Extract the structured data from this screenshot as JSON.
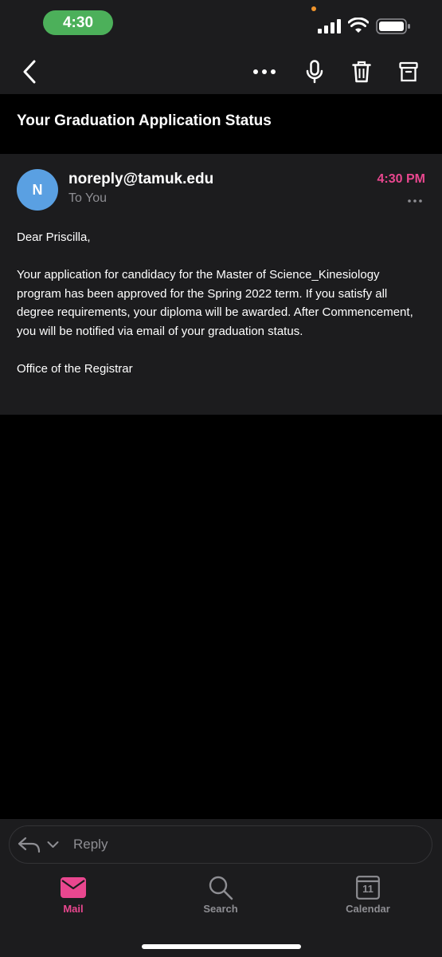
{
  "status_bar": {
    "time": "4:30"
  },
  "toolbar": {
    "back": "back-chevron-icon",
    "more": "more-horizontal-icon",
    "mic": "microphone-icon",
    "delete": "trash-icon",
    "archive": "archive-icon"
  },
  "email": {
    "subject": "Your Graduation Application Status",
    "avatar_initial": "N",
    "sender": "noreply@tamuk.edu",
    "recipient": "To You",
    "time": "4:30 PM",
    "body": {
      "greeting": "Dear Priscilla,",
      "paragraph": "Your application for candidacy for the Master of Science_Kinesiology program has been approved for the Spring 2022 term. If you satisfy all degree requirements, your diploma will be awarded. After Commencement, you will be notified via email of your graduation status.",
      "signature": "Office of the Registrar"
    }
  },
  "reply": {
    "label": "Reply"
  },
  "tabs": [
    {
      "label": "Mail",
      "active": true
    },
    {
      "label": "Search",
      "active": false
    },
    {
      "label": "Calendar",
      "active": false,
      "badge": "11"
    }
  ],
  "colors": {
    "accent": "#e9478f",
    "avatar": "#5aa0e2",
    "time_pill": "#4cb05a",
    "surface": "#1c1c1e"
  }
}
